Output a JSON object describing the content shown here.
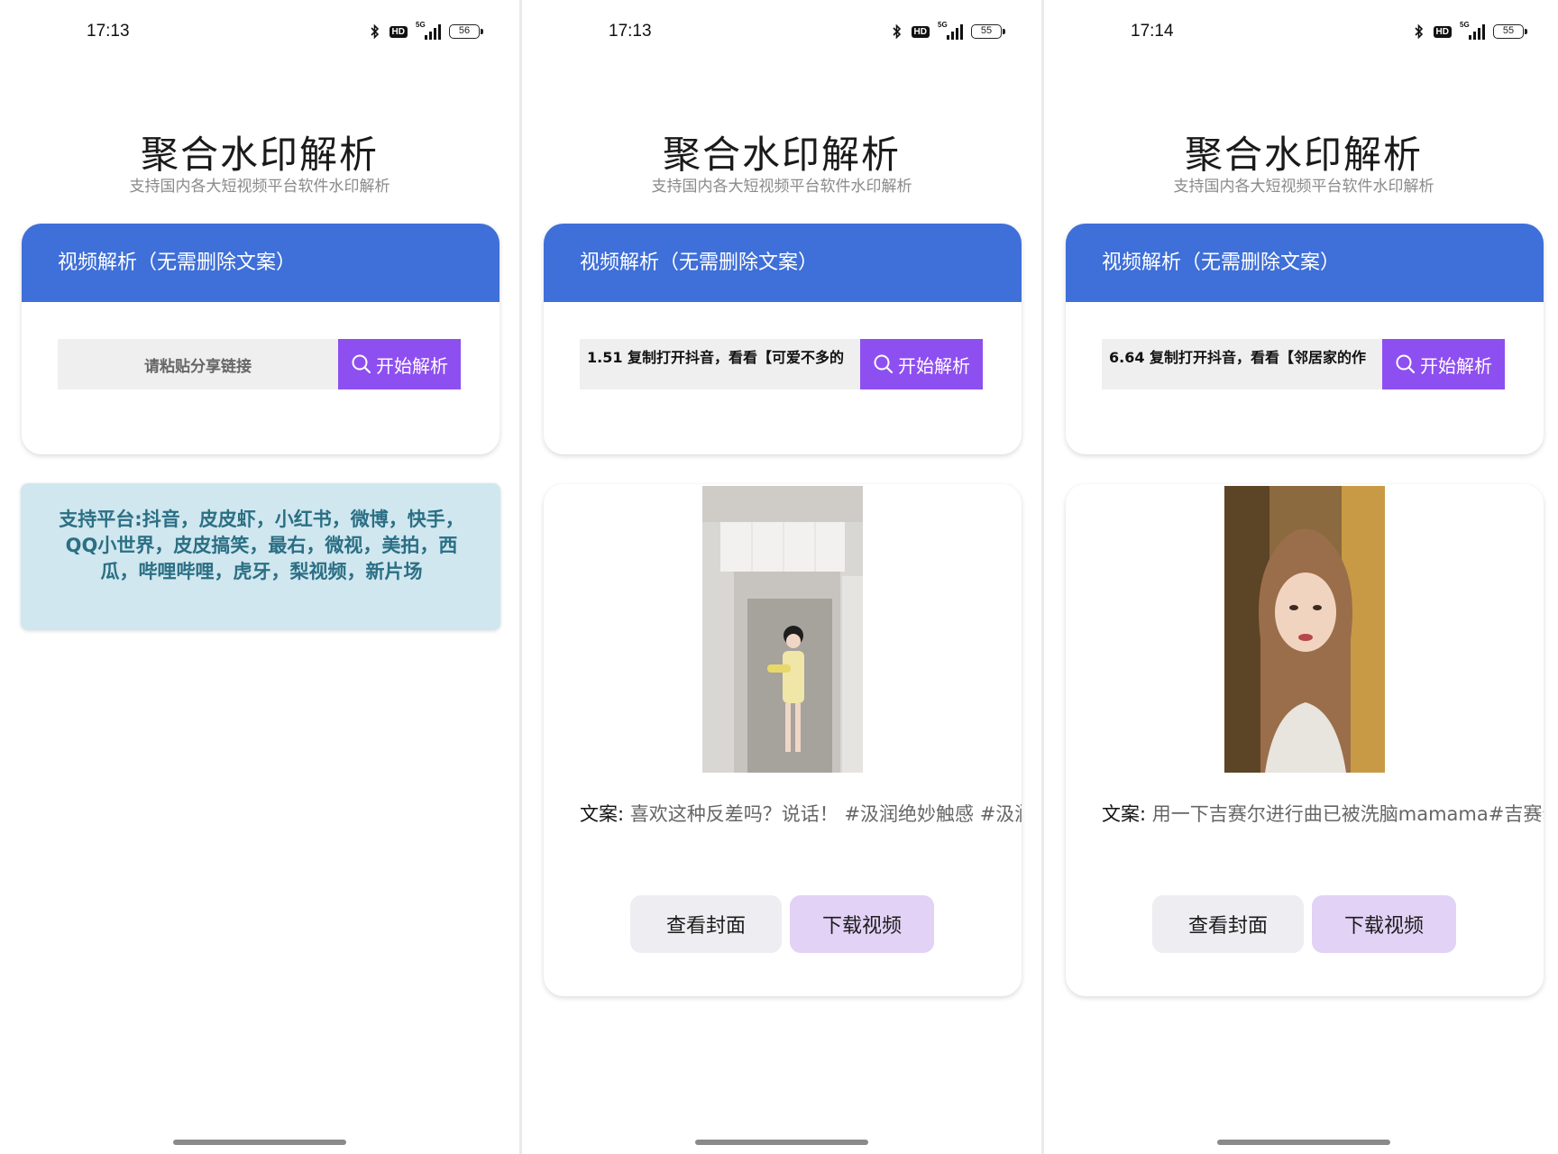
{
  "phones": [
    {
      "status": {
        "time": "17:13",
        "battery": "56"
      },
      "header": {
        "title": "聚合水印解析",
        "subtitle": "支持国内各大短视频平台软件水印解析"
      },
      "parse_card": {
        "title": "视频解析（无需删除文案）",
        "input_placeholder": "请粘贴分享链接",
        "input_value": "",
        "button_label": "开始解析"
      },
      "platforms": {
        "text": "支持平台:抖音，皮皮虾，小红书，微博，快手，QQ小世界，皮皮搞笑，最右，微视，美拍，西瓜，哔哩哔哩，虎牙，梨视频，新片场"
      }
    },
    {
      "status": {
        "time": "17:13",
        "battery": "55"
      },
      "header": {
        "title": "聚合水印解析",
        "subtitle": "支持国内各大短视频平台软件水印解析"
      },
      "parse_card": {
        "title": "视频解析（无需删除文案）",
        "input_value": "1.51 复制打开抖音，看看【可爱不多的",
        "button_label": "开始解析"
      },
      "result": {
        "caption_label": "文案:",
        "caption_text": "喜欢这种反差吗？说话！ #汲润绝妙触感 #汲润",
        "cover_button": "查看封面",
        "download_button": "下载视频"
      }
    },
    {
      "status": {
        "time": "17:14",
        "battery": "55"
      },
      "header": {
        "title": "聚合水印解析",
        "subtitle": "支持国内各大短视频平台软件水印解析"
      },
      "parse_card": {
        "title": "视频解析（无需删除文案）",
        "input_value": "6.64 复制打开抖音，看看【邻居家的作",
        "button_label": "开始解析"
      },
      "result": {
        "caption_label": "文案:",
        "caption_text": "用一下吉赛尔进行曲已被洗脑mamama#吉赛尔",
        "cover_button": "查看封面",
        "download_button": "下载视频"
      }
    }
  ],
  "status_icons": [
    "bluetooth-icon",
    "hd-icon",
    "5g-signal-icon",
    "battery-icon"
  ],
  "signal_label": "5G",
  "hd_label": "HD",
  "colors": {
    "header_blue": "#3f6fd8",
    "parse_purple": "#8e4ff0",
    "platform_bg": "#d0e7ef",
    "platform_text": "#2b6f84",
    "download_bg": "#e2d2f6"
  }
}
